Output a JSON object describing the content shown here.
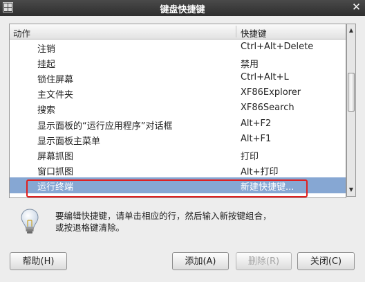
{
  "window": {
    "title": "键盘快捷键",
    "close_glyph": "✕"
  },
  "list": {
    "columns": [
      "动作",
      "快捷键"
    ],
    "rows": [
      {
        "action": "注销",
        "shortcut": "Ctrl+Alt+Delete"
      },
      {
        "action": "挂起",
        "shortcut": "禁用"
      },
      {
        "action": "锁住屏幕",
        "shortcut": "Ctrl+Alt+L"
      },
      {
        "action": "主文件夹",
        "shortcut": "XF86Explorer"
      },
      {
        "action": "搜索",
        "shortcut": "XF86Search"
      },
      {
        "action": "显示面板的“运行应用程序”对话框",
        "shortcut": "Alt+F2"
      },
      {
        "action": "显示面板主菜单",
        "shortcut": "Alt+F1"
      },
      {
        "action": "屏幕抓图",
        "shortcut": "打印"
      },
      {
        "action": "窗口抓图",
        "shortcut": "Alt+打印"
      },
      {
        "action": "运行终端",
        "shortcut": "新建快捷键..."
      }
    ],
    "selected_index": 9
  },
  "hint": {
    "text": "要编辑快捷键，请单击相应的行，然后输入新按键组合，或按退格键清除。"
  },
  "buttons": {
    "help": "帮助(H)",
    "add": "添加(A)",
    "remove": "删除(R)",
    "close": "关闭(C)"
  },
  "colors": {
    "selection": "#86a7d3",
    "highlight_box": "#e02020",
    "titlebar": "#3a3a3a"
  }
}
